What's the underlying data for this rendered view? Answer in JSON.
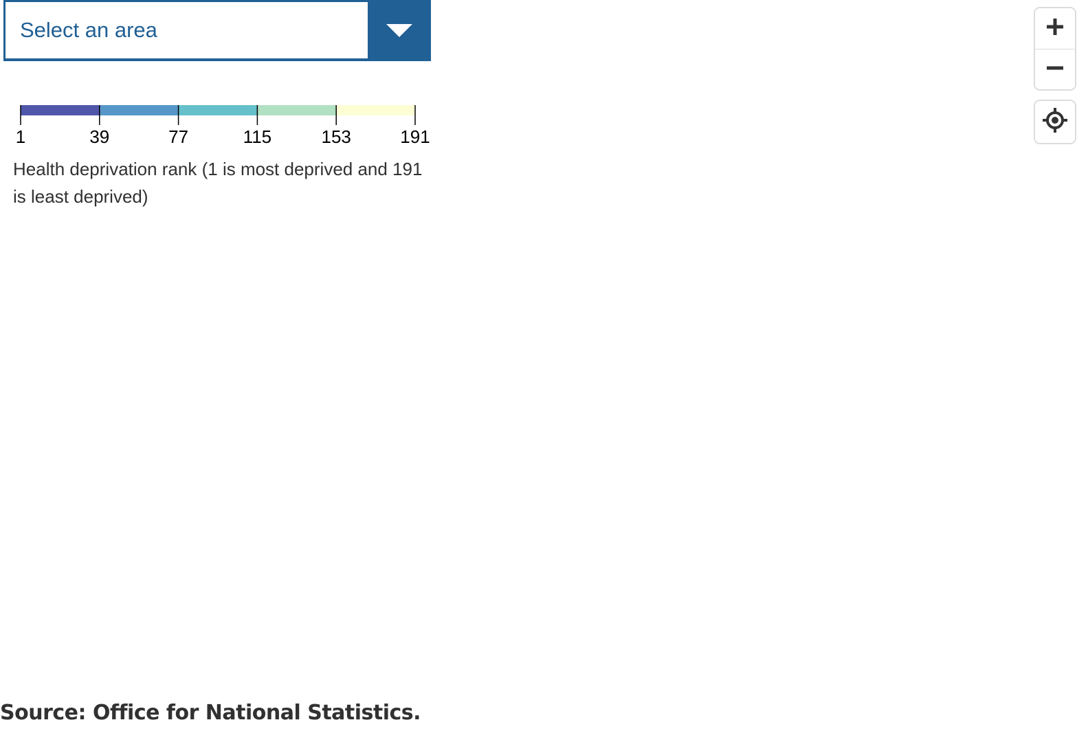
{
  "area_select": {
    "placeholder": "Select an area",
    "toggle_icon": "chevron-down-icon"
  },
  "legend": {
    "breaks": [
      "1",
      "39",
      "77",
      "115",
      "153",
      "191"
    ],
    "colors": [
      "#5057aa",
      "#5696c8",
      "#65c0ca",
      "#b2e0c2",
      "#fdfed4"
    ],
    "caption": "Health deprivation rank (1 is most deprived and 191 is least deprived)"
  },
  "map_controls": {
    "zoom_in_icon": "plus-icon",
    "zoom_out_icon": "minus-icon",
    "locate_icon": "crosshair-icon"
  },
  "source": "Source: Office for National Statistics.",
  "colors": {
    "accent": "#206095",
    "text": "#323132",
    "control_border": "#dcdcdc"
  }
}
